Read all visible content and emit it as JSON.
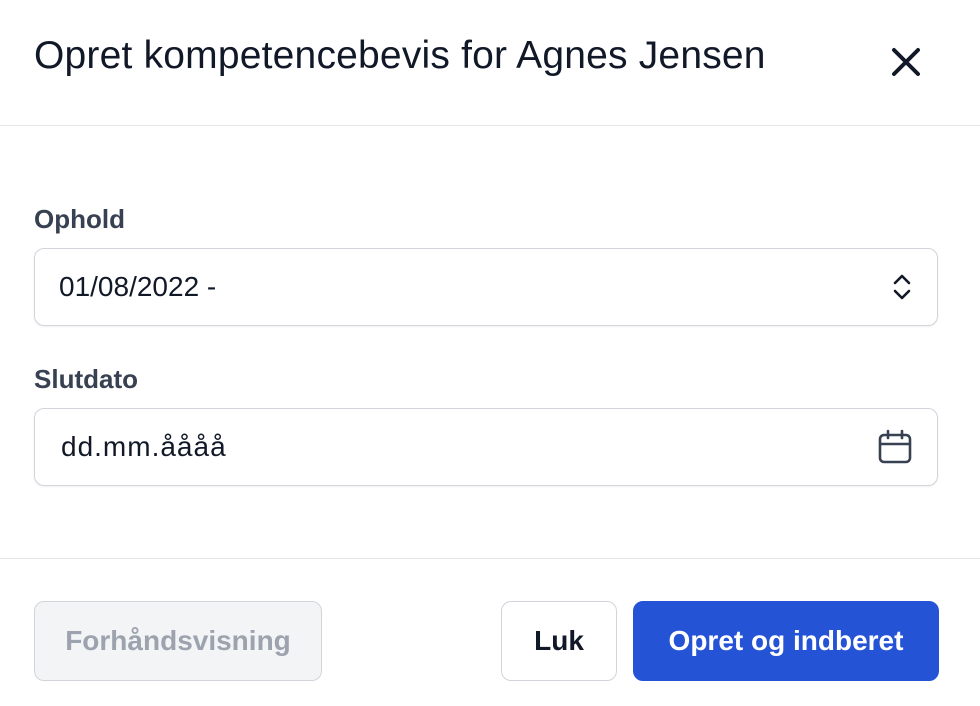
{
  "header": {
    "title": "Opret kompetencebevis for Agnes Jensen",
    "close_icon": "close-icon"
  },
  "form": {
    "stay": {
      "label": "Ophold",
      "value": "01/08/2022 -",
      "icon": "chevron-up-down-icon"
    },
    "end_date": {
      "label": "Slutdato",
      "placeholder": "dd.mm.åååå",
      "icon": "calendar-icon"
    }
  },
  "footer": {
    "preview_label": "Forhåndsvisning",
    "close_label": "Luk",
    "submit_label": "Opret og indberet"
  },
  "colors": {
    "primary": "#2553d6",
    "border": "#d1d5db",
    "disabled_text": "#9ca3af"
  }
}
